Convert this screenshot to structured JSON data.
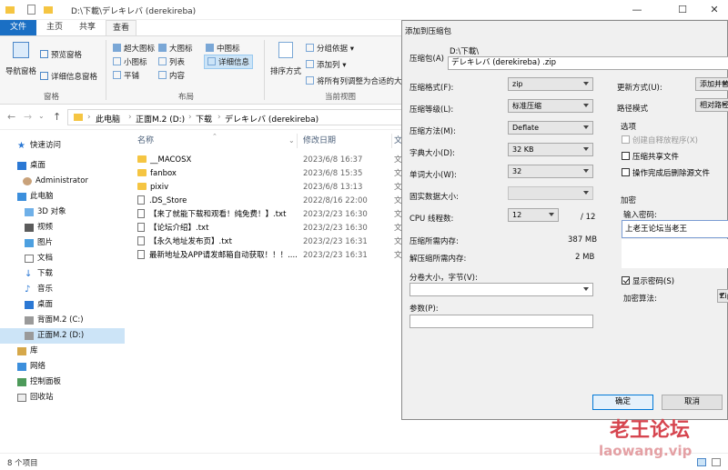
{
  "explorer": {
    "title_path": "D:\\下載\\デレキレバ (derekireba)",
    "tabs": [
      "文件",
      "主页",
      "共享",
      "查看"
    ],
    "ribbon": {
      "nav_pane": "导航窗格",
      "preview_pane": "预览窗格",
      "details_pane": "详细信息窗格",
      "group_pane": "窗格",
      "xlarge_icons": "超大图标",
      "large_icons": "大图标",
      "medium_icons": "中图标",
      "small_icons": "小图标",
      "list": "列表",
      "details": "详细信息",
      "tiles": "平铺",
      "content": "内容",
      "group_layout": "布局",
      "sort_by": "排序方式",
      "group_by": "分组依据 ▾",
      "add_columns": "添加列 ▾",
      "fit_columns": "将所有列调整为合适的大",
      "group_current_view": "当前视图"
    },
    "breadcrumb": [
      "此电脑",
      "正面M.2 (D:)",
      "下载",
      "デレキレバ (derekireba)"
    ],
    "nav_items": [
      {
        "label": "快速访问",
        "icon": "star-icon"
      },
      {
        "label": "桌面",
        "icon": "desktop-icon"
      },
      {
        "label": "Administrator",
        "icon": "user-icon"
      },
      {
        "label": "此电脑",
        "icon": "computer-icon"
      },
      {
        "label": "3D 对象",
        "icon": "cube-icon"
      },
      {
        "label": "视频",
        "icon": "video-icon"
      },
      {
        "label": "图片",
        "icon": "picture-icon"
      },
      {
        "label": "文档",
        "icon": "document-icon"
      },
      {
        "label": "下载",
        "icon": "download-icon"
      },
      {
        "label": "音乐",
        "icon": "music-icon"
      },
      {
        "label": "桌面",
        "icon": "desktop-icon"
      },
      {
        "label": "背面M.2 (C:)",
        "icon": "drive-icon"
      },
      {
        "label": "正面M.2 (D:)",
        "icon": "drive-icon"
      },
      {
        "label": "库",
        "icon": "library-icon"
      },
      {
        "label": "网络",
        "icon": "network-icon"
      },
      {
        "label": "控制面板",
        "icon": "control-panel-icon"
      },
      {
        "label": "回收站",
        "icon": "recycle-bin-icon"
      }
    ],
    "columns": {
      "name": "名称",
      "modified": "修改日期",
      "type": "文"
    },
    "files": [
      {
        "name": "__MACOSX",
        "date": "2023/6/8 16:37",
        "type": "文",
        "kind": "folder"
      },
      {
        "name": "fanbox",
        "date": "2023/6/8 15:35",
        "type": "文",
        "kind": "folder"
      },
      {
        "name": "pixiv",
        "date": "2023/6/8 13:13",
        "type": "文",
        "kind": "folder"
      },
      {
        "name": ".DS_Store",
        "date": "2022/8/16 22:00",
        "type": "文",
        "kind": "file"
      },
      {
        "name": "【来了就能下载和观看！纯免费！】.txt",
        "date": "2023/2/23 16:30",
        "type": "文",
        "kind": "file"
      },
      {
        "name": "【论坛介绍】.txt",
        "date": "2023/2/23 16:30",
        "type": "文",
        "kind": "file"
      },
      {
        "name": "【永久地址发布页】.txt",
        "date": "2023/2/23 16:31",
        "type": "文",
        "kind": "file"
      },
      {
        "name": "最新地址及APP请发邮箱自动获取！！！....",
        "date": "2023/2/23 16:31",
        "type": "文",
        "kind": "file"
      }
    ],
    "status": "8 个项目"
  },
  "dialog": {
    "title": "添加到压缩包",
    "archive_label": "压缩包(A)",
    "archive_dir": "D:\\下載\\",
    "archive_name": "デレキレバ (derekireba) .zip",
    "format_label": "压缩格式(F):",
    "format_value": "zip",
    "level_label": "压缩等级(L):",
    "level_value": "标准压缩",
    "method_label": "压缩方法(M):",
    "method_value": "Deflate",
    "dict_label": "字典大小(D):",
    "dict_value": "32 KB",
    "word_label": "单词大小(W):",
    "word_value": "32",
    "solid_label": "固实数据大小:",
    "threads_label": "CPU 线程数:",
    "threads_value": "12",
    "threads_max": "/ 12",
    "mem_compress_label": "压缩所需内存:",
    "mem_compress_value": "387 MB",
    "mem_decompress_label": "解压缩所需内存:",
    "mem_decompress_value": "2 MB",
    "split_label": "分卷大小，字节(V):",
    "params_label": "参数(P):",
    "update_label": "更新方式(U):",
    "update_value": "添加并替",
    "path_label": "路径模式",
    "path_value": "相对路径",
    "options_title": "选项",
    "opt_sfx": "创建自释放程序(X)",
    "opt_shared": "压缩共享文件",
    "opt_delete": "操作完成后删除源文件",
    "encrypt_title": "加密",
    "password_label": "输入密码:",
    "password_value": "上老王论坛当老王",
    "show_password": "显示密码(S)",
    "encrypt_method_label": "加密算法:",
    "encrypt_method_value": "Zip",
    "ok": "确定",
    "cancel": "取消"
  },
  "watermark": {
    "line1": "老王论坛",
    "line2": "laowang.vip"
  }
}
